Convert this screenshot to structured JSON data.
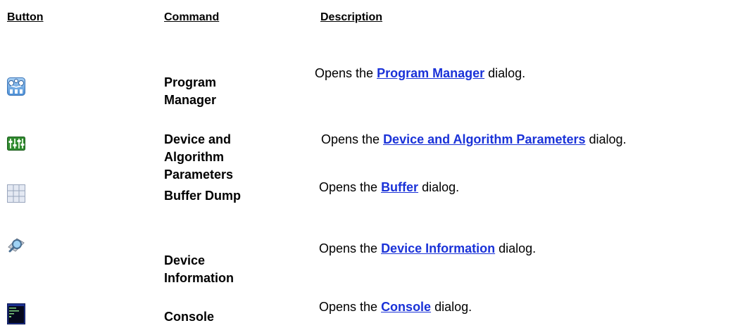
{
  "headers": {
    "button": "Button",
    "command": "Command",
    "description": "Description"
  },
  "rows": [
    {
      "icon": "program-manager-icon",
      "command_lines": [
        "Program",
        "Manager"
      ],
      "desc_before": "Opens the ",
      "link": "Program Manager",
      "desc_after": " dialog."
    },
    {
      "icon": "device-algorithm-parameters-icon",
      "command_lines": [
        "Device and",
        "Algorithm",
        "Parameters"
      ],
      "desc_before": "Opens the ",
      "link": "Device and Algorithm Parameters",
      "desc_after": " dialog."
    },
    {
      "icon": "buffer-dump-icon",
      "command_lines": [
        "Buffer Dump"
      ],
      "desc_before": "Opens the ",
      "link": "Buffer",
      "desc_after": " dialog."
    },
    {
      "icon": "device-information-icon",
      "command_lines": [
        "Device",
        "Information"
      ],
      "desc_before": "Opens the ",
      "link": "Device Information",
      "desc_after": " dialog."
    },
    {
      "icon": "console-icon",
      "command_lines": [
        "Console"
      ],
      "desc_before": "Opens the ",
      "link": "Console",
      "desc_after": " dialog."
    }
  ],
  "colors": {
    "link": "#1a32d8",
    "text": "#000000",
    "background": "#ffffff"
  }
}
